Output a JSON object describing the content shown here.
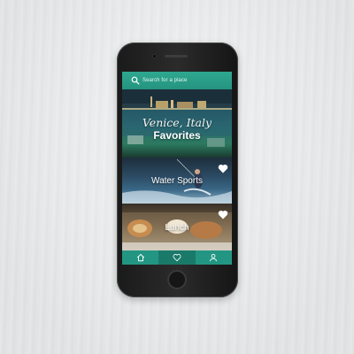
{
  "search": {
    "placeholder": "Search for a place"
  },
  "cards": [
    {
      "subtitle": "Venice, Italy",
      "title": "Favorites"
    },
    {
      "title": "Water Sports",
      "favorited": true
    },
    {
      "title": "Lunch",
      "favorited": true
    }
  ],
  "tabbar": {
    "items": [
      {
        "icon": "home-icon"
      },
      {
        "icon": "heart-icon",
        "active": true
      },
      {
        "icon": "profile-icon"
      }
    ]
  },
  "colors": {
    "accent": "#2aa08a",
    "accent_dark": "#1a7a69"
  }
}
